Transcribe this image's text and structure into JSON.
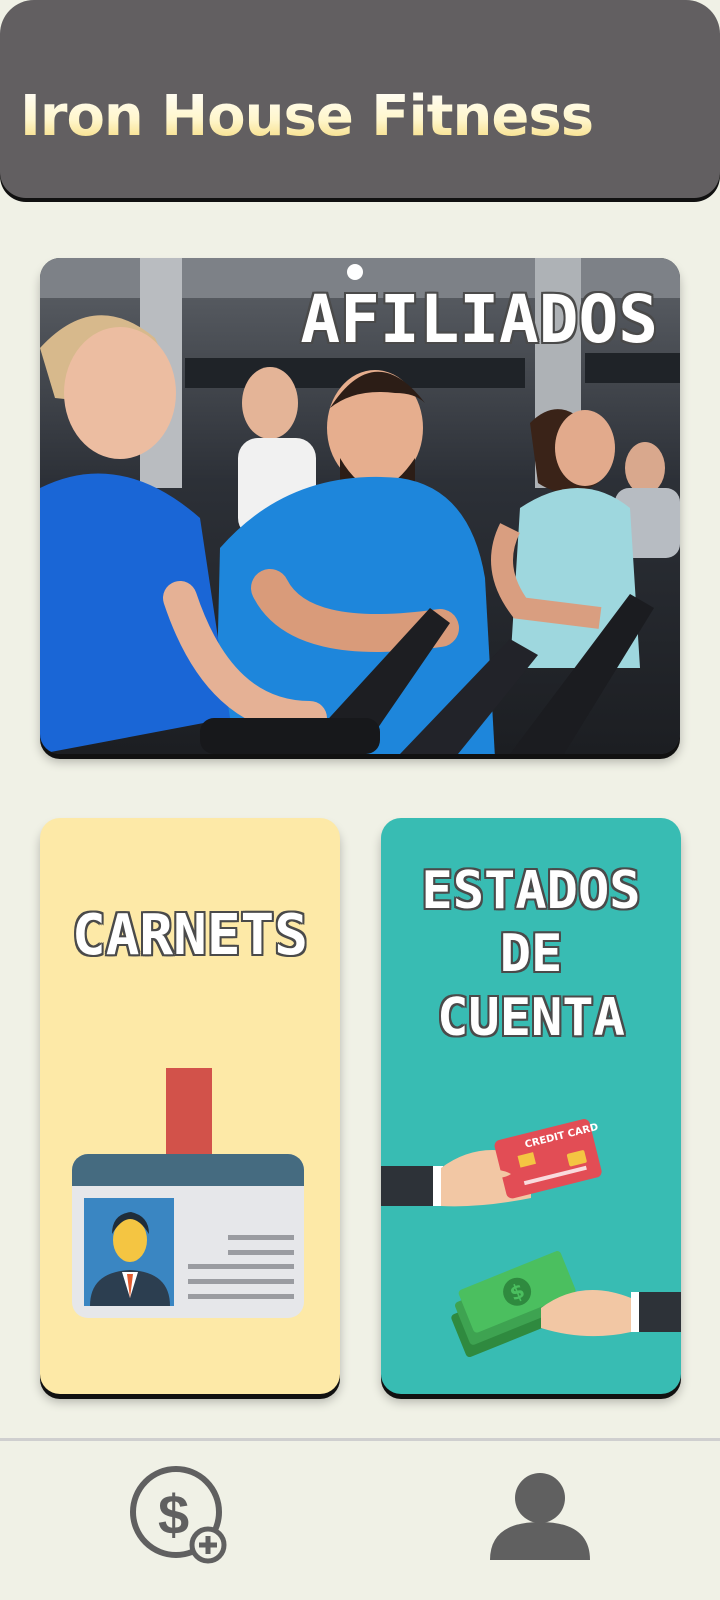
{
  "header": {
    "title": "Iron House Fitness"
  },
  "cards": {
    "afiliados": {
      "label": "AFILIADOS"
    },
    "carnets": {
      "label": "CARNETS"
    },
    "estados": {
      "label_lines": [
        "ESTADOS",
        "DE",
        "CUENTA"
      ]
    }
  },
  "illustrations": {
    "credit_card_text": "CREDIT CARD"
  },
  "bottom_nav": {
    "items": [
      {
        "icon": "dollar-add-icon"
      },
      {
        "icon": "user-profile-icon"
      }
    ]
  },
  "colors": {
    "header_bg": "#625f61",
    "page_bg": "#f0f1e6",
    "carnets_bg": "#fde9a7",
    "estados_bg": "#38bcb3",
    "icon_gray": "#606060"
  }
}
